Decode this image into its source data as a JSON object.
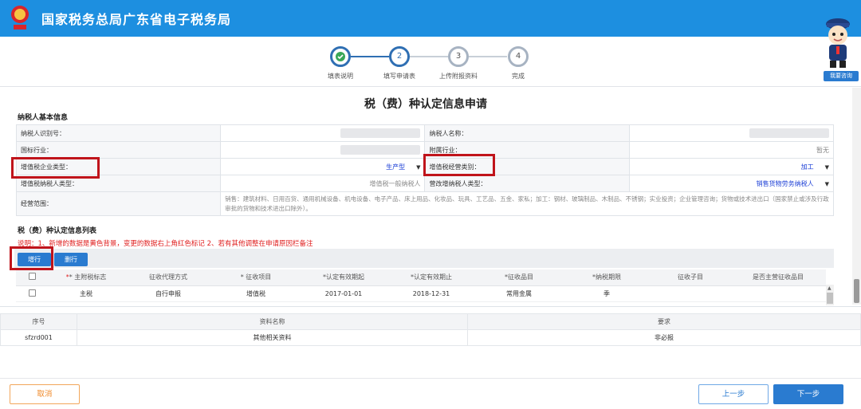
{
  "header": {
    "title": "国家税务总局广东省电子税务局"
  },
  "steps": [
    {
      "num": "1",
      "label": "填表说明",
      "state": "done"
    },
    {
      "num": "2",
      "label": "填写申请表",
      "state": "active"
    },
    {
      "num": "3",
      "label": "上传附报资料",
      "state": "todo"
    },
    {
      "num": "4",
      "label": "完成",
      "state": "todo"
    }
  ],
  "consult": {
    "label": "我要咨询"
  },
  "form": {
    "title": "税（费）种认定信息申请",
    "basic_section": "纳税人基本信息",
    "rows": {
      "taxpayer_id_label": "纳税人识别号：",
      "taxpayer_name_label": "纳税人名称：",
      "industry_label": "国标行业：",
      "sub_industry_label": "附属行业：",
      "sub_industry_value": "暂无",
      "vat_enterprise_type_label": "增值税企业类型：",
      "vat_enterprise_type_value": "生产型",
      "vat_business_category_label": "增值税经营类别：",
      "vat_business_category_value": "加工",
      "vat_taxpayer_type_label": "增值税纳税人类型：",
      "vat_taxpayer_type_value": "增值税一般纳税人",
      "ygz_taxpayer_type_label": "营改增纳税人类型：",
      "ygz_taxpayer_type_value": "销售货物劳务纳税人",
      "scope_label": "经营范围：",
      "scope_value": "销售：建筑材料、日用百货、通用机械设备、机电设备、电子产品、床上用品、化妆品、玩具、工艺品、五金、家私；加工：钢材、玻璃制品、木制品、不锈钢；实业投资；企业管理咨询；货物或技术进出口（国家禁止或涉及行政审批的货物和技术进出口除外）。"
    },
    "list_section": "税（费）种认定信息列表",
    "note": "说明：1、新增的数据是黄色背景，变更的数据右上角红色标记 2、若有其他调整在申请原因栏备注",
    "add_button": "增行",
    "delete_button": "删行",
    "grid_headers": [
      "* 主附税标志",
      "征收代理方式",
      "* 征收项目",
      "*认定有效期起",
      "*认定有效期止",
      "*征收品目",
      "*纳税期限",
      "征收子目",
      "是否主营征收品目"
    ],
    "grid_rows": [
      [
        "主税",
        "自行申报",
        "增值税",
        "2017-01-01",
        "2018-12-31",
        "常用金属",
        "季",
        "",
        ""
      ]
    ]
  },
  "docs": {
    "headers": [
      "序号",
      "资料名称",
      "要求"
    ],
    "rows": [
      [
        "sfzrd001",
        "其他相关资料",
        "非必报"
      ]
    ]
  },
  "footer": {
    "cancel": "取消",
    "prev": "上一步",
    "next": "下一步"
  },
  "colors": {
    "brand": "#1d8fe0",
    "accent": "#2a7bd0",
    "highlight": "#c0141b",
    "warning": "#e02020"
  }
}
